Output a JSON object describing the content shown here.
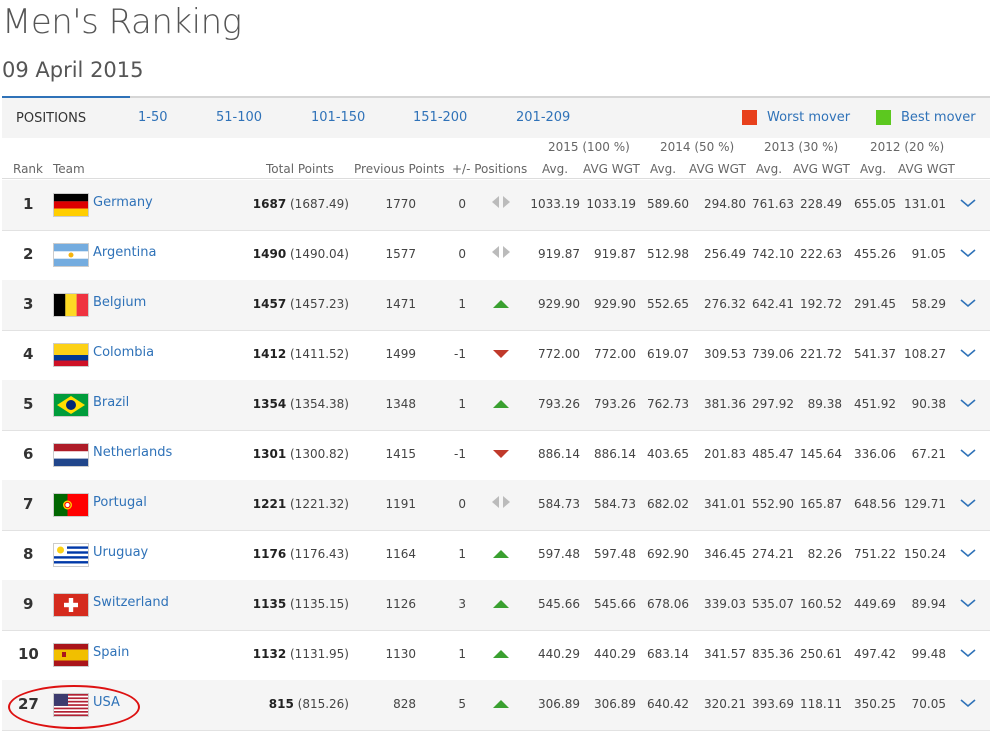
{
  "page": {
    "title": "Men's Ranking",
    "date": "09 April 2015"
  },
  "topbar": {
    "positions_label": "POSITIONS",
    "ranges": [
      "1-50",
      "51-100",
      "101-150",
      "151-200",
      "201-209"
    ],
    "worst_mover_label": "Worst mover",
    "best_mover_label": "Best mover",
    "worst_color": "#e8401c",
    "best_color": "#5cc81f"
  },
  "headers": {
    "years": [
      "2015 (100 %)",
      "2014 (50 %)",
      "2013 (30 %)",
      "2012 (20 %)"
    ],
    "rank": "Rank",
    "team": "Team",
    "total_points": "Total Points",
    "previous_points": "Previous Points",
    "positions": "+/- Positions",
    "avg": "Avg.",
    "avg_wgt": "AVG WGT"
  },
  "rows": [
    {
      "rank": "1",
      "team": "Germany",
      "flag": "germany-flag",
      "pts": "1687",
      "pts_exact": "(1687.49)",
      "prev": "1770",
      "delta": "0",
      "move": "same",
      "v": [
        "1033.19",
        "1033.19",
        "589.60",
        "294.80",
        "761.63",
        "228.49",
        "655.05",
        "131.01"
      ]
    },
    {
      "rank": "2",
      "team": "Argentina",
      "flag": "argentina-flag",
      "pts": "1490",
      "pts_exact": "(1490.04)",
      "prev": "1577",
      "delta": "0",
      "move": "same",
      "v": [
        "919.87",
        "919.87",
        "512.98",
        "256.49",
        "742.10",
        "222.63",
        "455.26",
        "91.05"
      ]
    },
    {
      "rank": "3",
      "team": "Belgium",
      "flag": "belgium-flag",
      "pts": "1457",
      "pts_exact": "(1457.23)",
      "prev": "1471",
      "delta": "1",
      "move": "up",
      "v": [
        "929.90",
        "929.90",
        "552.65",
        "276.32",
        "642.41",
        "192.72",
        "291.45",
        "58.29"
      ]
    },
    {
      "rank": "4",
      "team": "Colombia",
      "flag": "colombia-flag",
      "pts": "1412",
      "pts_exact": "(1411.52)",
      "prev": "1499",
      "delta": "-1",
      "move": "down",
      "v": [
        "772.00",
        "772.00",
        "619.07",
        "309.53",
        "739.06",
        "221.72",
        "541.37",
        "108.27"
      ]
    },
    {
      "rank": "5",
      "team": "Brazil",
      "flag": "brazil-flag",
      "pts": "1354",
      "pts_exact": "(1354.38)",
      "prev": "1348",
      "delta": "1",
      "move": "up",
      "v": [
        "793.26",
        "793.26",
        "762.73",
        "381.36",
        "297.92",
        "89.38",
        "451.92",
        "90.38"
      ]
    },
    {
      "rank": "6",
      "team": "Netherlands",
      "flag": "netherlands-flag",
      "pts": "1301",
      "pts_exact": "(1300.82)",
      "prev": "1415",
      "delta": "-1",
      "move": "down",
      "v": [
        "886.14",
        "886.14",
        "403.65",
        "201.83",
        "485.47",
        "145.64",
        "336.06",
        "67.21"
      ]
    },
    {
      "rank": "7",
      "team": "Portugal",
      "flag": "portugal-flag",
      "pts": "1221",
      "pts_exact": "(1221.32)",
      "prev": "1191",
      "delta": "0",
      "move": "same",
      "v": [
        "584.73",
        "584.73",
        "682.02",
        "341.01",
        "552.90",
        "165.87",
        "648.56",
        "129.71"
      ]
    },
    {
      "rank": "8",
      "team": "Uruguay",
      "flag": "uruguay-flag",
      "pts": "1176",
      "pts_exact": "(1176.43)",
      "prev": "1164",
      "delta": "1",
      "move": "up",
      "v": [
        "597.48",
        "597.48",
        "692.90",
        "346.45",
        "274.21",
        "82.26",
        "751.22",
        "150.24"
      ]
    },
    {
      "rank": "9",
      "team": "Switzerland",
      "flag": "switzerland-flag",
      "pts": "1135",
      "pts_exact": "(1135.15)",
      "prev": "1126",
      "delta": "3",
      "move": "up",
      "v": [
        "545.66",
        "545.66",
        "678.06",
        "339.03",
        "535.07",
        "160.52",
        "449.69",
        "89.94"
      ]
    },
    {
      "rank": "10",
      "team": "Spain",
      "flag": "spain-flag",
      "pts": "1132",
      "pts_exact": "(1131.95)",
      "prev": "1130",
      "delta": "1",
      "move": "up",
      "v": [
        "440.29",
        "440.29",
        "683.14",
        "341.57",
        "835.36",
        "250.61",
        "497.42",
        "99.48"
      ]
    },
    {
      "rank": "27",
      "team": "USA",
      "flag": "usa-flag",
      "pts": "815",
      "pts_exact": "(815.26)",
      "prev": "828",
      "delta": "5",
      "move": "up",
      "v": [
        "306.89",
        "306.89",
        "640.42",
        "320.21",
        "393.69",
        "118.11",
        "350.25",
        "70.05"
      ]
    }
  ]
}
